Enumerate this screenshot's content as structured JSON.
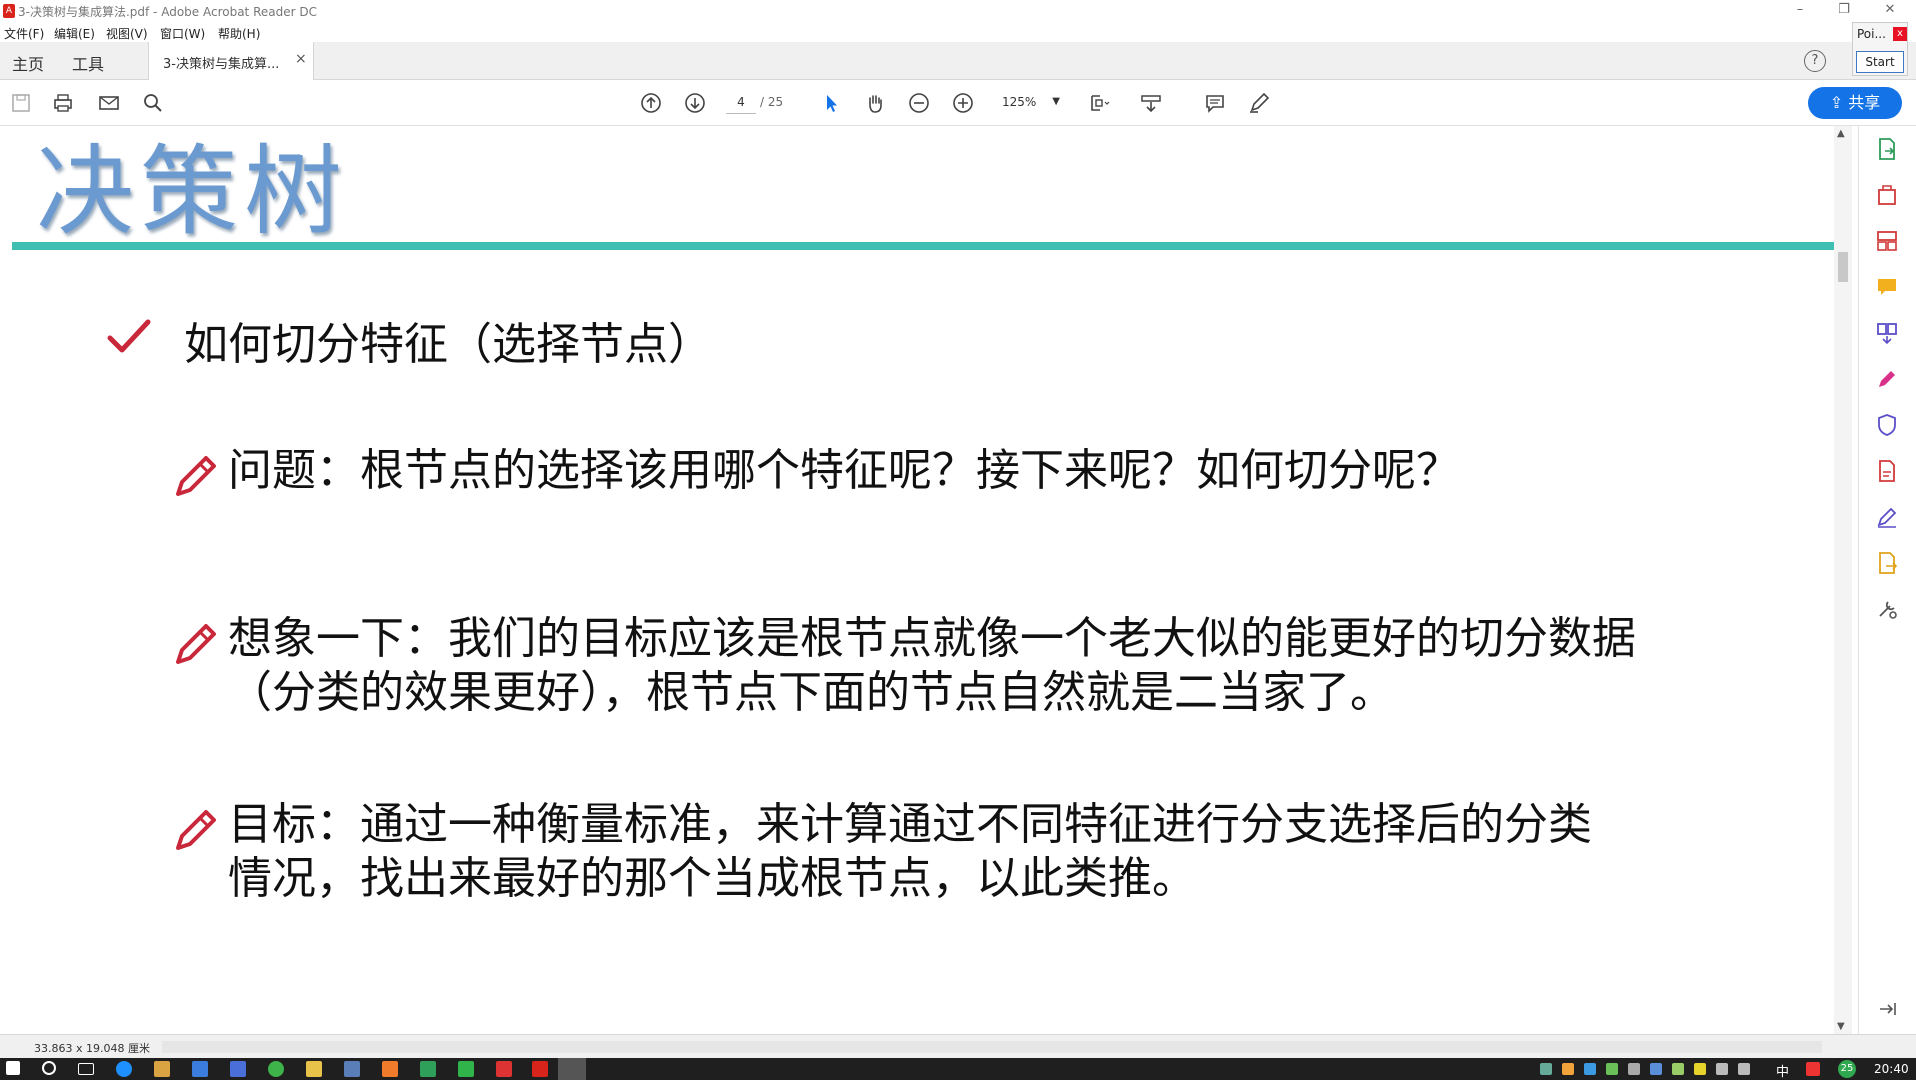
{
  "window": {
    "title": "3-决策树与集成算法.pdf - Adobe Acrobat Reader DC"
  },
  "menu": [
    "文件(F)",
    "编辑(E)",
    "视图(V)",
    "窗口(W)",
    "帮助(H)"
  ],
  "tabs": {
    "home": "主页",
    "tools": "工具",
    "document": "3-决策树与集成算...",
    "close": "×"
  },
  "help_label": "?",
  "poi_popup": {
    "title": "Poi...",
    "close": "x",
    "start_button": "Start"
  },
  "toolbar": {
    "current_page": "4",
    "total_pages": "/ 25",
    "zoom": "125%",
    "share_label": "共享"
  },
  "document": {
    "heading": "决策树",
    "section_title": "如何切分特征（选择节点）",
    "paragraphs": [
      {
        "lines": [
          "问题：根节点的选择该用哪个特征呢？接下来呢？如何切分呢？"
        ]
      },
      {
        "lines": [
          "想象一下：我们的目标应该是根节点就像一个老大似的能更好的切分数据",
          "（分类的效果更好），根节点下面的节点自然就是二当家了。"
        ]
      },
      {
        "lines": [
          "目标：通过一种衡量标准，来计算通过不同特征进行分支选择后的分类",
          "情况，找出来最好的那个当成根节点，以此类推。"
        ]
      }
    ],
    "colors": {
      "heading": "#6b9ad0",
      "rule": "#3fbfb2",
      "bullet": "#c8283a"
    }
  },
  "statusbar": {
    "page_size": "33.863 x 19.048 厘米"
  },
  "taskbar": {
    "ime": "中",
    "time": "20:40",
    "badge": "25"
  }
}
